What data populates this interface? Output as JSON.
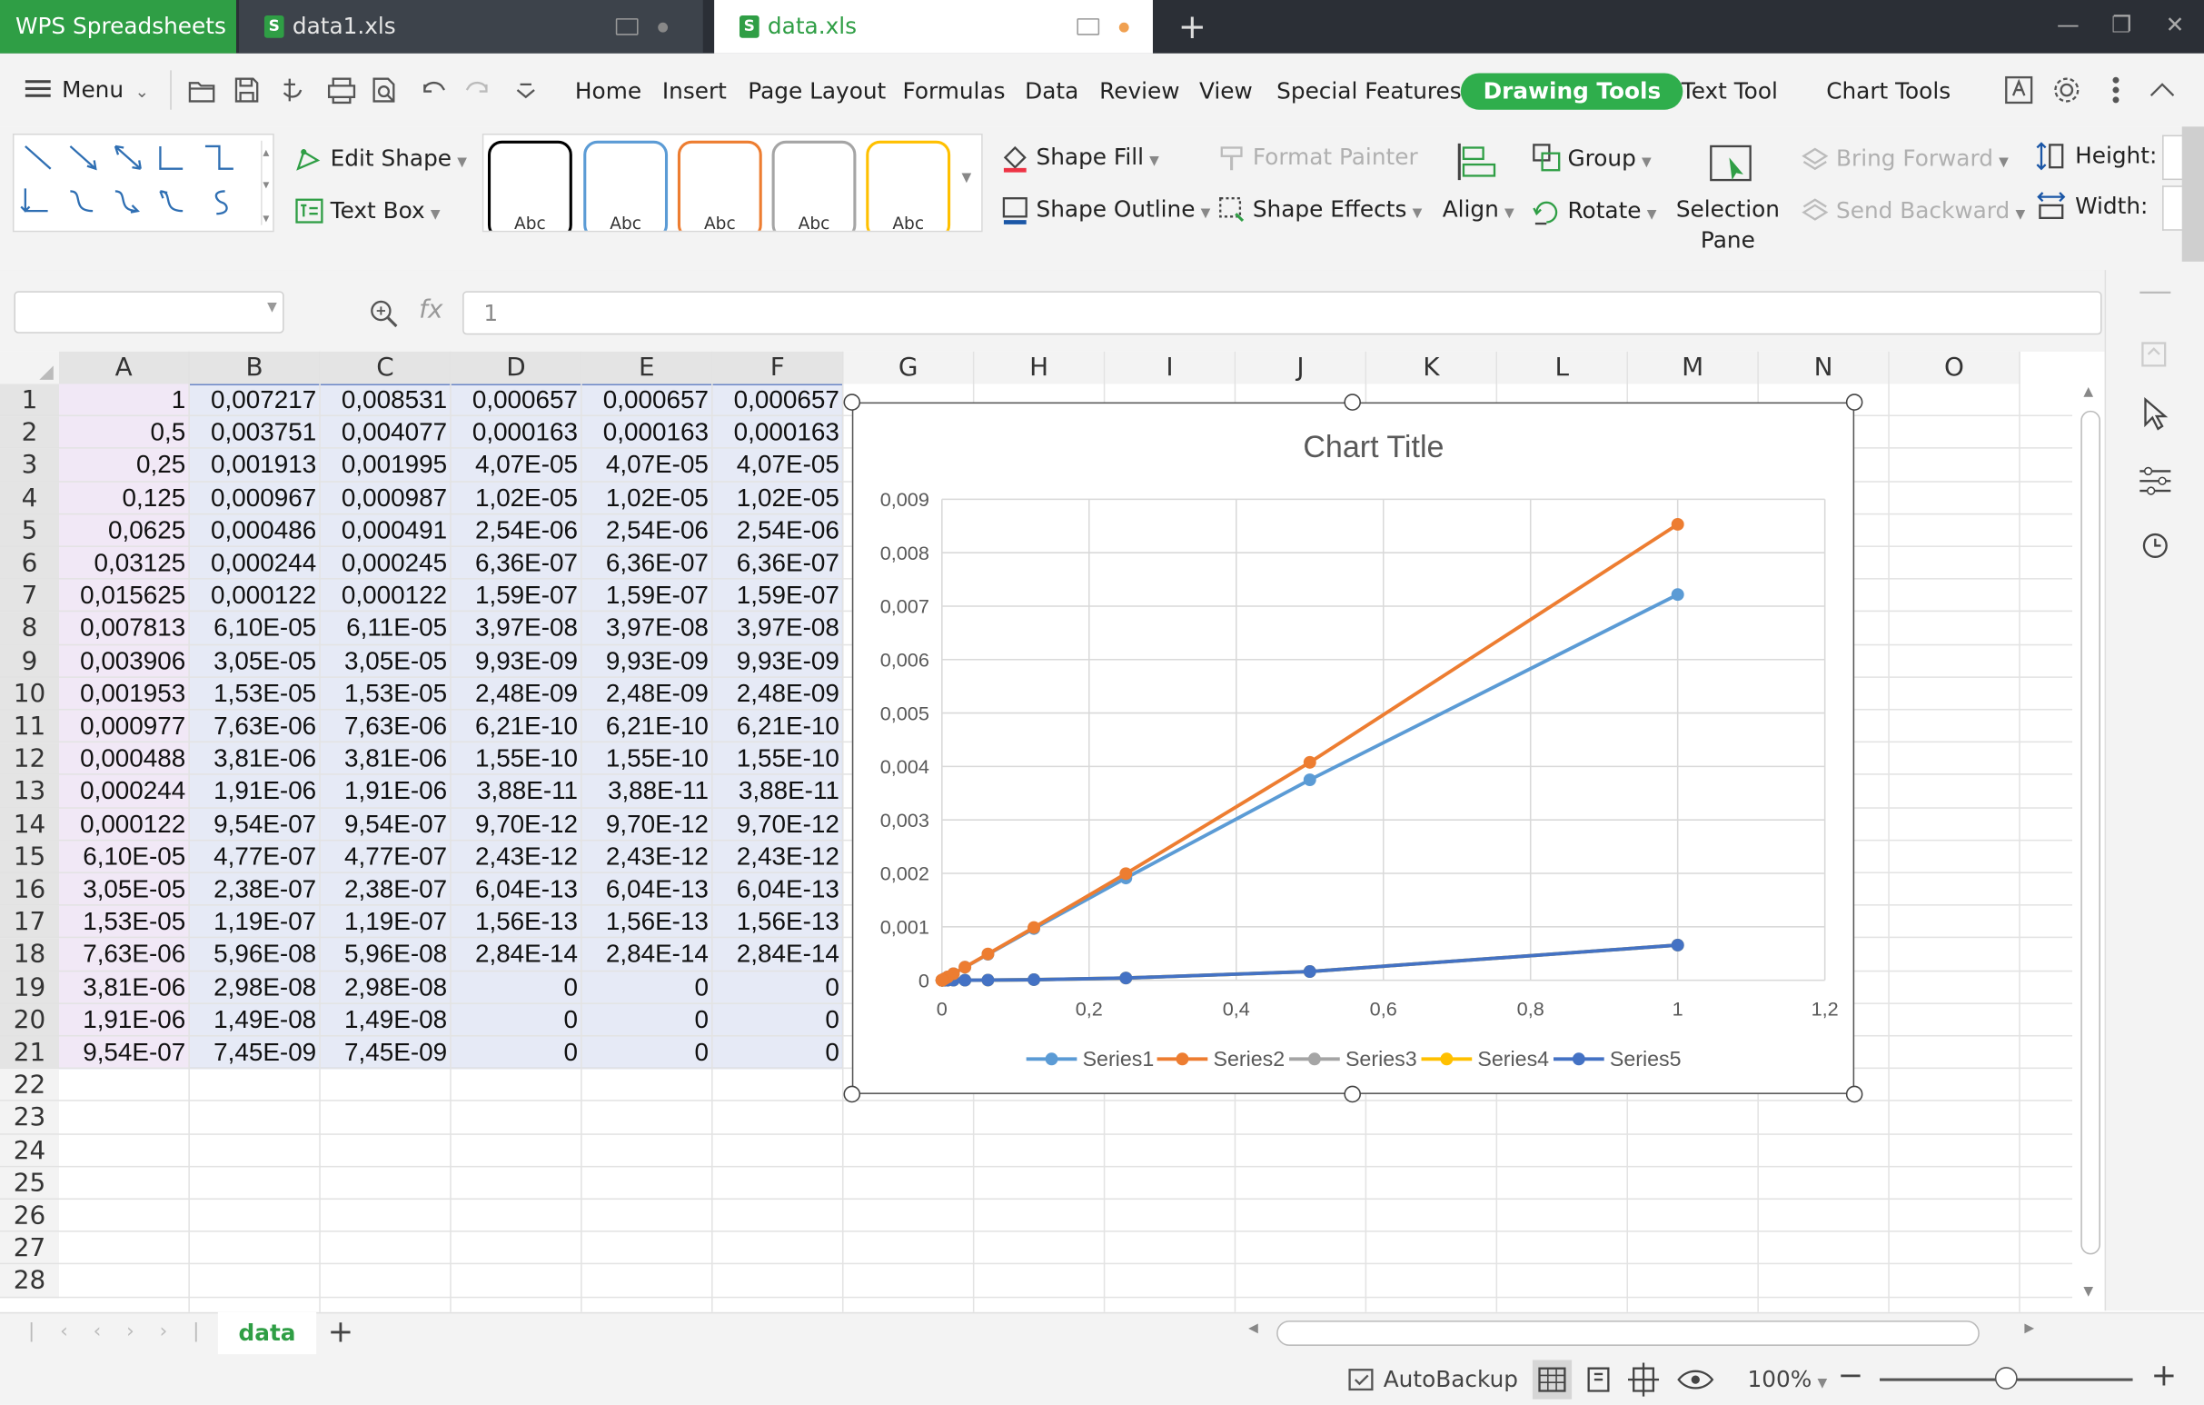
{
  "app": {
    "name": "WPS Spreadsheets"
  },
  "tabs": [
    {
      "label": "data1.xls",
      "active": false
    },
    {
      "label": "data.xls",
      "active": true
    }
  ],
  "menu": {
    "label": "Menu",
    "tabs": [
      "Home",
      "Insert",
      "Page Layout",
      "Formulas",
      "Data",
      "Review",
      "View",
      "Special Features",
      "Drawing Tools",
      "Text Tool",
      "Chart Tools"
    ],
    "active_tab": "Drawing Tools"
  },
  "ribbon": {
    "edit_shape": "Edit Shape",
    "text_box": "Text Box",
    "style_sample": "Abc",
    "style_colors": [
      "#000000",
      "#5b9bd5",
      "#ed7d31",
      "#a5a5a5",
      "#ffc000"
    ],
    "shape_fill": "Shape Fill",
    "shape_outline": "Shape Outline",
    "format_painter": "Format Painter",
    "shape_effects": "Shape Effects",
    "align": "Align",
    "group": "Group",
    "rotate": "Rotate",
    "selection_pane_1": "Selection",
    "selection_pane_2": "Pane",
    "bring_forward": "Bring Forward",
    "send_backward": "Send Backward",
    "height": "Height:",
    "width": "Width:"
  },
  "formula_bar": {
    "fx": "fx",
    "value": "1"
  },
  "sheet": {
    "columns": [
      "A",
      "B",
      "C",
      "D",
      "E",
      "F",
      "G",
      "H",
      "I",
      "J",
      "K",
      "L",
      "M",
      "N",
      "O"
    ],
    "rows": [
      "1",
      "2",
      "3",
      "4",
      "5",
      "6",
      "7",
      "8",
      "9",
      "10",
      "11",
      "12",
      "13",
      "14",
      "15",
      "16",
      "17",
      "18",
      "19",
      "20",
      "21",
      "22",
      "23",
      "24",
      "25",
      "26",
      "27",
      "28"
    ],
    "data": [
      [
        "1",
        "0,007217",
        "0,008531",
        "0,000657",
        "0,000657",
        "0,000657"
      ],
      [
        "0,5",
        "0,003751",
        "0,004077",
        "0,000163",
        "0,000163",
        "0,000163"
      ],
      [
        "0,25",
        "0,001913",
        "0,001995",
        "4,07E-05",
        "4,07E-05",
        "4,07E-05"
      ],
      [
        "0,125",
        "0,000967",
        "0,000987",
        "1,02E-05",
        "1,02E-05",
        "1,02E-05"
      ],
      [
        "0,0625",
        "0,000486",
        "0,000491",
        "2,54E-06",
        "2,54E-06",
        "2,54E-06"
      ],
      [
        "0,03125",
        "0,000244",
        "0,000245",
        "6,36E-07",
        "6,36E-07",
        "6,36E-07"
      ],
      [
        "0,015625",
        "0,000122",
        "0,000122",
        "1,59E-07",
        "1,59E-07",
        "1,59E-07"
      ],
      [
        "0,007813",
        "6,10E-05",
        "6,11E-05",
        "3,97E-08",
        "3,97E-08",
        "3,97E-08"
      ],
      [
        "0,003906",
        "3,05E-05",
        "3,05E-05",
        "9,93E-09",
        "9,93E-09",
        "9,93E-09"
      ],
      [
        "0,001953",
        "1,53E-05",
        "1,53E-05",
        "2,48E-09",
        "2,48E-09",
        "2,48E-09"
      ],
      [
        "0,000977",
        "7,63E-06",
        "7,63E-06",
        "6,21E-10",
        "6,21E-10",
        "6,21E-10"
      ],
      [
        "0,000488",
        "3,81E-06",
        "3,81E-06",
        "1,55E-10",
        "1,55E-10",
        "1,55E-10"
      ],
      [
        "0,000244",
        "1,91E-06",
        "1,91E-06",
        "3,88E-11",
        "3,88E-11",
        "3,88E-11"
      ],
      [
        "0,000122",
        "9,54E-07",
        "9,54E-07",
        "9,70E-12",
        "9,70E-12",
        "9,70E-12"
      ],
      [
        "6,10E-05",
        "4,77E-07",
        "4,77E-07",
        "2,43E-12",
        "2,43E-12",
        "2,43E-12"
      ],
      [
        "3,05E-05",
        "2,38E-07",
        "2,38E-07",
        "6,04E-13",
        "6,04E-13",
        "6,04E-13"
      ],
      [
        "1,53E-05",
        "1,19E-07",
        "1,19E-07",
        "1,56E-13",
        "1,56E-13",
        "1,56E-13"
      ],
      [
        "7,63E-06",
        "5,96E-08",
        "5,96E-08",
        "2,84E-14",
        "2,84E-14",
        "2,84E-14"
      ],
      [
        "3,81E-06",
        "2,98E-08",
        "2,98E-08",
        "0",
        "0",
        "0"
      ],
      [
        "1,91E-06",
        "1,49E-08",
        "1,49E-08",
        "0",
        "0",
        "0"
      ],
      [
        "9,54E-07",
        "7,45E-09",
        "7,45E-09",
        "0",
        "0",
        "0"
      ]
    ]
  },
  "chart_data": {
    "type": "scatter",
    "title": "Chart Title",
    "xlim": [
      0,
      1.2
    ],
    "ylim": [
      0,
      0.009
    ],
    "x_ticks": [
      "0",
      "0,2",
      "0,4",
      "0,6",
      "0,8",
      "1",
      "1,2"
    ],
    "y_ticks": [
      "0",
      "0,001",
      "0,002",
      "0,003",
      "0,004",
      "0,005",
      "0,006",
      "0,007",
      "0,008",
      "0,009"
    ],
    "grid": true,
    "legend": "bottom",
    "x": [
      1,
      0.5,
      0.25,
      0.125,
      0.0625,
      0.03125,
      0.015625,
      0.007813,
      0.003906,
      0.001953,
      0.000977,
      0.000488,
      0.000244,
      0.000122,
      6.1e-05,
      3.05e-05,
      1.53e-05,
      7.63e-06,
      3.81e-06,
      1.91e-06,
      9.54e-07
    ],
    "series": [
      {
        "name": "Series1",
        "color": "#5b9bd5",
        "values": [
          0.007217,
          0.003751,
          0.001913,
          0.000967,
          0.000486,
          0.000244,
          0.000122,
          6.1e-05,
          3.05e-05,
          1.53e-05,
          7.63e-06,
          3.81e-06,
          1.91e-06,
          9.54e-07,
          4.77e-07,
          2.38e-07,
          1.19e-07,
          5.96e-08,
          2.98e-08,
          1.49e-08,
          7.45e-09
        ]
      },
      {
        "name": "Series2",
        "color": "#ed7d31",
        "values": [
          0.008531,
          0.004077,
          0.001995,
          0.000987,
          0.000491,
          0.000245,
          0.000122,
          6.11e-05,
          3.05e-05,
          1.53e-05,
          7.63e-06,
          3.81e-06,
          1.91e-06,
          9.54e-07,
          4.77e-07,
          2.38e-07,
          1.19e-07,
          5.96e-08,
          2.98e-08,
          1.49e-08,
          7.45e-09
        ]
      },
      {
        "name": "Series3",
        "color": "#a5a5a5",
        "values": [
          0.000657,
          0.000163,
          4.07e-05,
          1.02e-05,
          2.54e-06,
          6.36e-07,
          1.59e-07,
          3.97e-08,
          9.93e-09,
          2.48e-09,
          6.21e-10,
          1.55e-10,
          3.88e-11,
          9.7e-12,
          2.43e-12,
          6.04e-13,
          1.56e-13,
          2.84e-14,
          0,
          0,
          0
        ]
      },
      {
        "name": "Series4",
        "color": "#ffc000",
        "values": [
          0.000657,
          0.000163,
          4.07e-05,
          1.02e-05,
          2.54e-06,
          6.36e-07,
          1.59e-07,
          3.97e-08,
          9.93e-09,
          2.48e-09,
          6.21e-10,
          1.55e-10,
          3.88e-11,
          9.7e-12,
          2.43e-12,
          6.04e-13,
          1.56e-13,
          2.84e-14,
          0,
          0,
          0
        ]
      },
      {
        "name": "Series5",
        "color": "#4472c4",
        "values": [
          0.000657,
          0.000163,
          4.07e-05,
          1.02e-05,
          2.54e-06,
          6.36e-07,
          1.59e-07,
          3.97e-08,
          9.93e-09,
          2.48e-09,
          6.21e-10,
          1.55e-10,
          3.88e-11,
          9.7e-12,
          2.43e-12,
          6.04e-13,
          1.56e-13,
          2.84e-14,
          0,
          0,
          0
        ]
      }
    ]
  },
  "sheet_tabs": [
    {
      "label": "data",
      "active": true
    }
  ],
  "status": {
    "autobackup": "AutoBackup",
    "zoom": "100%"
  },
  "colors": {
    "brand": "#2f9e45",
    "active_tab_bg": "#2fae4c",
    "titlebar": "#2b2f36"
  }
}
